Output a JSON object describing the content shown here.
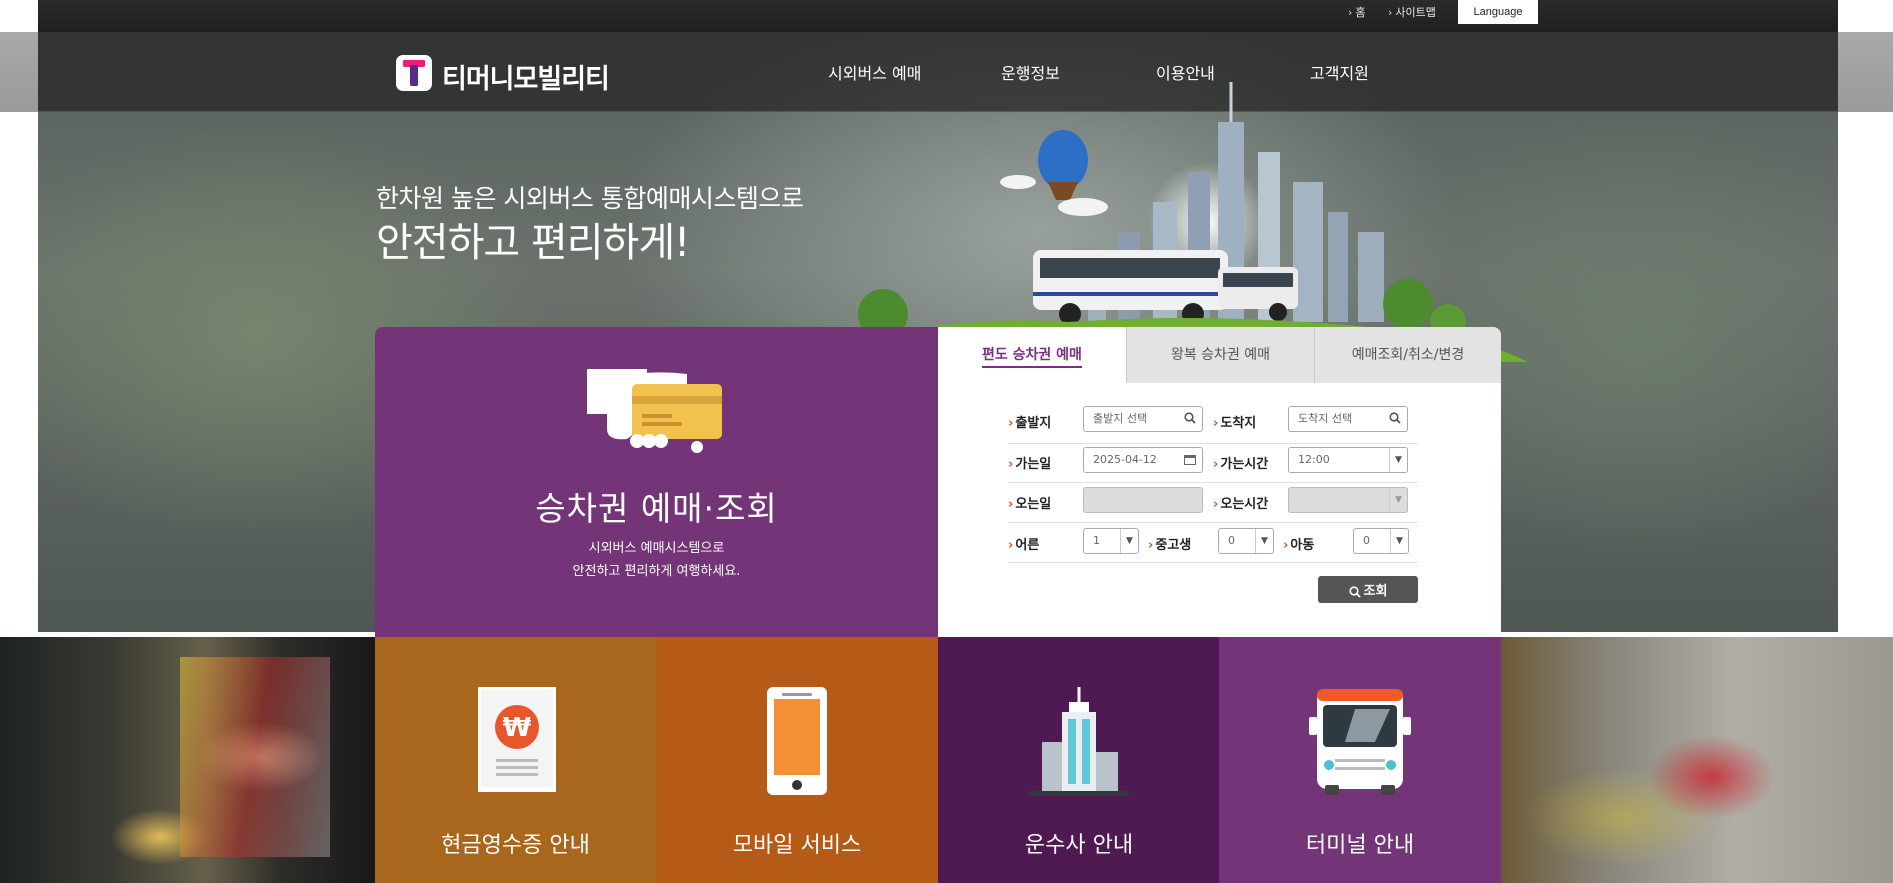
{
  "topbar": {
    "home_label": "홈",
    "sitemap_label": "사이트맵",
    "language_label": "Language"
  },
  "header": {
    "logo_text": "티머니모빌리티",
    "nav": [
      "시외버스 예매",
      "운행정보",
      "이용안내",
      "고객지원"
    ]
  },
  "hero": {
    "subtitle": "한차원 높은 시외버스 통합예매시스템으로",
    "title": "안전하고 편리하게!"
  },
  "promo": {
    "title": "승차권 예매·조회",
    "desc_line1": "시외버스 예매시스템으로",
    "desc_line2": "안전하고 편리하게 여행하세요."
  },
  "tabs": [
    "편도 승차권 예매",
    "왕복 승차권 예매",
    "예매조회/취소/변경"
  ],
  "form": {
    "departure_label": "출발지",
    "departure_placeholder": "출발지 선택",
    "arrival_label": "도착지",
    "arrival_placeholder": "도착지 선택",
    "go_date_label": "가는일",
    "go_date_value": "2025-04-12",
    "go_time_label": "가는시간",
    "go_time_value": "12:00",
    "return_date_label": "오는일",
    "return_date_value": "",
    "return_time_label": "오는시간",
    "return_time_value": "",
    "adult_label": "어른",
    "adult_value": "1",
    "teen_label": "중고생",
    "teen_value": "0",
    "child_label": "아동",
    "child_value": "0",
    "search_label": "조회"
  },
  "tiles": [
    {
      "label": "현금영수증 안내",
      "icon": "receipt-won-icon",
      "color": "#a8671d"
    },
    {
      "label": "모바일 서비스",
      "icon": "smartphone-icon",
      "color": "#b55a17"
    },
    {
      "label": "운수사 안내",
      "icon": "building-icon",
      "color": "#4f1a52"
    },
    {
      "label": "터미널 안내",
      "icon": "bus-front-icon",
      "color": "#743578"
    }
  ],
  "colors": {
    "brand_purple": "#743578",
    "accent_orange": "#d4561b",
    "topbar_dark": "#2b2b2b"
  }
}
